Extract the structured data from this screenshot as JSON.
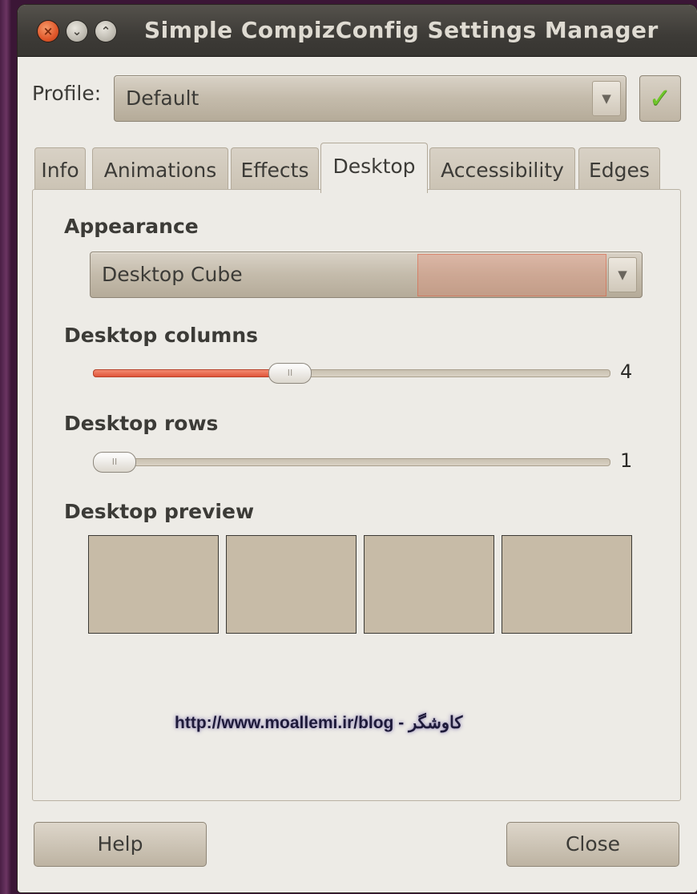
{
  "window": {
    "title": "Simple CompizConfig Settings Manager",
    "buttons": {
      "close": "×",
      "minimize": "⌄",
      "maximize": "⌃"
    }
  },
  "profile": {
    "label": "Profile:",
    "value": "Default",
    "arrow": "▼",
    "apply": "✓"
  },
  "tabs": [
    {
      "label": "Info"
    },
    {
      "label": "Animations"
    },
    {
      "label": "Effects"
    },
    {
      "label": "Desktop",
      "active": true
    },
    {
      "label": "Accessibility"
    },
    {
      "label": "Edges"
    }
  ],
  "desktop": {
    "appearance": {
      "heading": "Appearance",
      "value": "Desktop Cube",
      "arrow": "▼"
    },
    "columns": {
      "heading": "Desktop columns",
      "value": 4,
      "fraction": 0.37,
      "knob": "II"
    },
    "rows": {
      "heading": "Desktop rows",
      "value": 1,
      "fraction": 0.0,
      "knob": "II"
    },
    "preview": {
      "heading": "Desktop preview",
      "cells": 4
    }
  },
  "watermark": "http://www.moallemi.ir/blog - کاوشگر",
  "footer": {
    "help": "Help",
    "close": "Close"
  },
  "colors": {
    "accent": "#e0553a",
    "titlebar": "#3d3b37",
    "preview": "#c7bba7"
  }
}
